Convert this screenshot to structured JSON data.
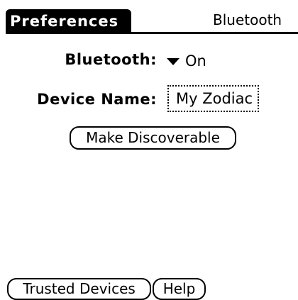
{
  "title_bar": {
    "app_title": "Preferences",
    "panel_name": "Bluetooth"
  },
  "form": {
    "bluetooth_label": "Bluetooth:",
    "bluetooth_value": "On",
    "device_name_label": "Device Name:",
    "device_name_value": "My Zodiac"
  },
  "buttons": {
    "make_discoverable": "Make Discoverable",
    "trusted_devices": "Trusted Devices",
    "help": "Help"
  }
}
